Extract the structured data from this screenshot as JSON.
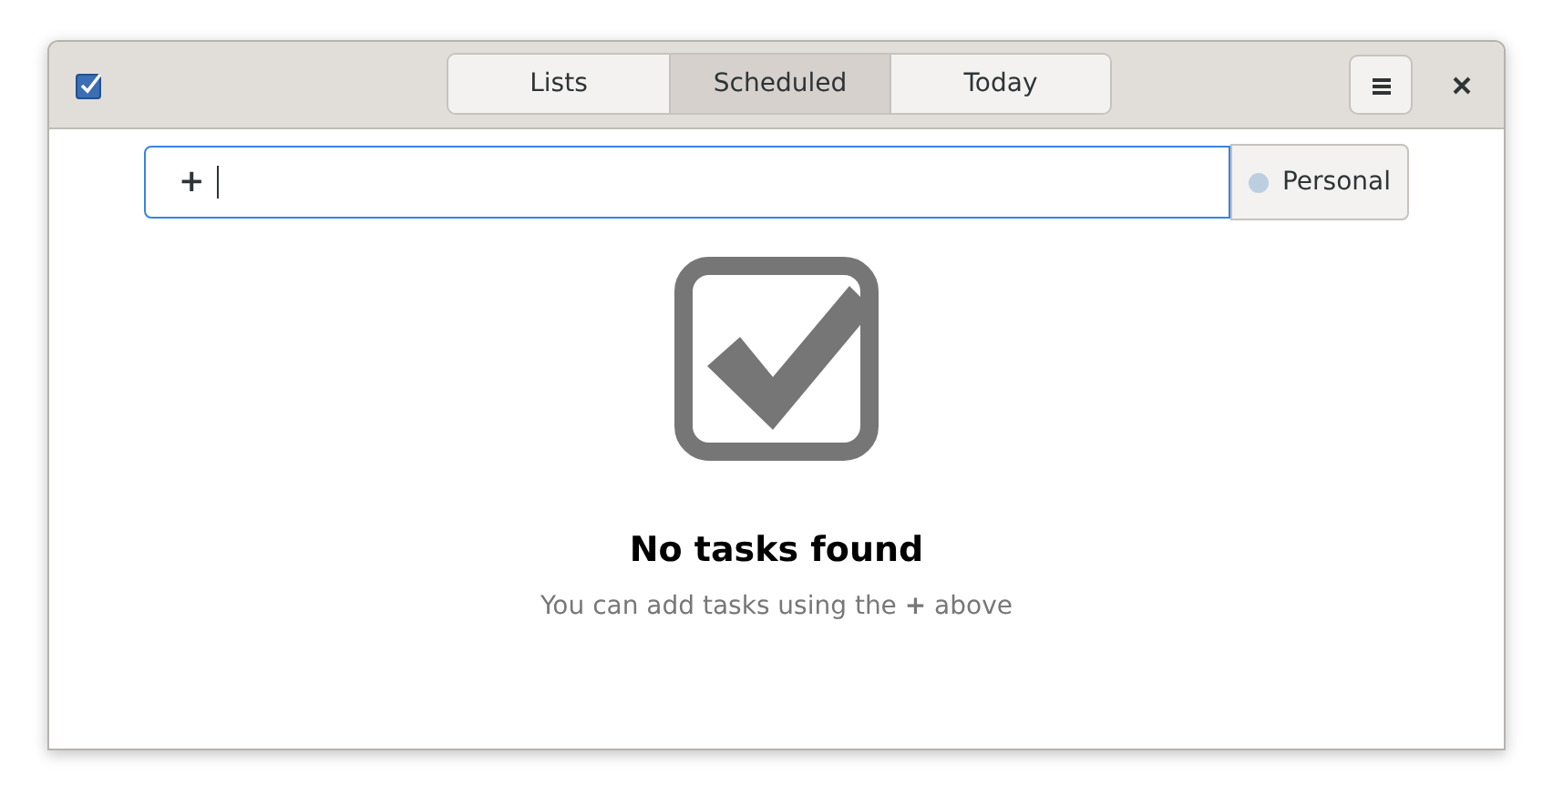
{
  "window": {
    "tabs": [
      {
        "label": "Lists",
        "selected": false
      },
      {
        "label": "Scheduled",
        "selected": true
      },
      {
        "label": "Today",
        "selected": false
      }
    ]
  },
  "new_task": {
    "prefix": "+",
    "list": {
      "label": "Personal",
      "color": "#bccfe0"
    }
  },
  "empty_state": {
    "title": "No tasks found",
    "message": "You can add tasks using the **+** above"
  }
}
